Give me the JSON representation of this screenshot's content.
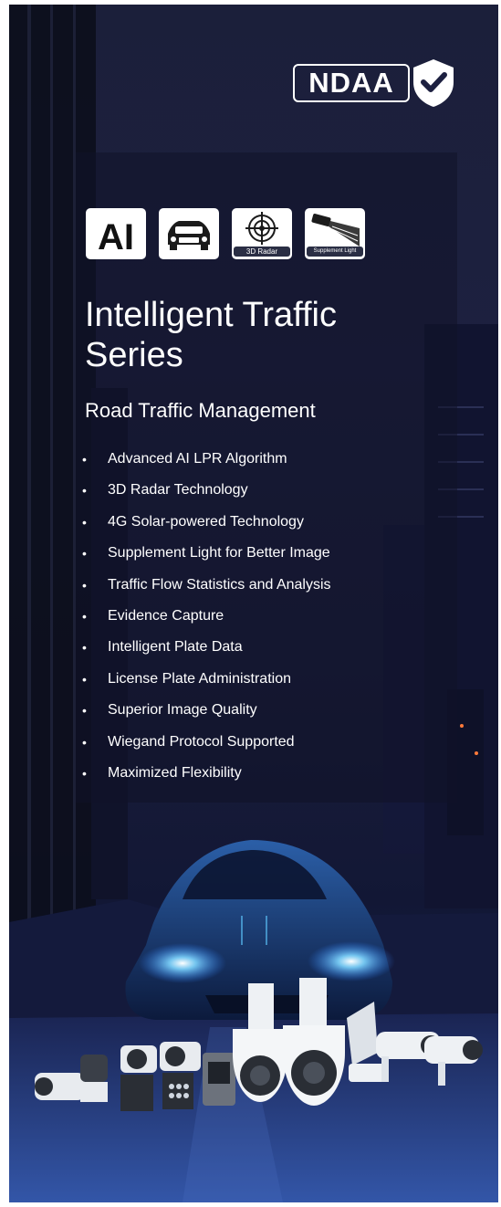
{
  "badge": {
    "text": "NDAA",
    "icon": "shield-check-icon"
  },
  "feature_icons": [
    {
      "name": "ai-icon",
      "glyph": "AI"
    },
    {
      "name": "car-lpr-icon"
    },
    {
      "name": "radar-icon",
      "caption": "3D Radar"
    },
    {
      "name": "supplement-light-icon",
      "caption": "Supplement Light"
    }
  ],
  "title": {
    "line1": "Intelligent Traffic",
    "line2": "Series"
  },
  "subtitle": "Road Traffic Management",
  "bullet": "•",
  "features": [
    "Advanced AI LPR Algorithm",
    "3D Radar Technology",
    "4G Solar-powered Technology",
    "Supplement Light for Better Image",
    "Traffic Flow Statistics and Analysis",
    "Evidence Capture",
    "Intelligent Plate Data",
    "License Plate Administration",
    "Superior Image Quality",
    "Wiegand Protocol Supported",
    "Maximized Flexibility"
  ],
  "colors": {
    "background": "#1b1f3a",
    "headlight": "#5ec8ff",
    "text": "#ffffff",
    "tile": "#ffffff"
  }
}
